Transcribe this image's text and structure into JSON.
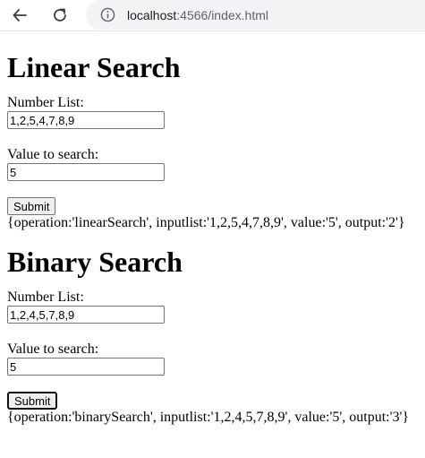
{
  "browser": {
    "url_host": "localhost",
    "url_rest": ":4566/index.html"
  },
  "linear": {
    "title": "Linear Search",
    "list_label": "Number List:",
    "list_value": "1,2,5,4,7,8,9",
    "value_label": "Value to search:",
    "value_value": "5",
    "submit_label": "Submit",
    "output": "{operation:'linearSearch', inputlist:'1,2,5,4,7,8,9', value:'5', output:'2'}"
  },
  "binary": {
    "title": "Binary Search",
    "list_label": "Number List:",
    "list_value": "1,2,4,5,7,8,9",
    "value_label": "Value to search:",
    "value_value": "5",
    "submit_label": "Submit",
    "output": "{operation:'binarySearch', inputlist:'1,2,4,5,7,8,9', value:'5', output:'3'}"
  }
}
